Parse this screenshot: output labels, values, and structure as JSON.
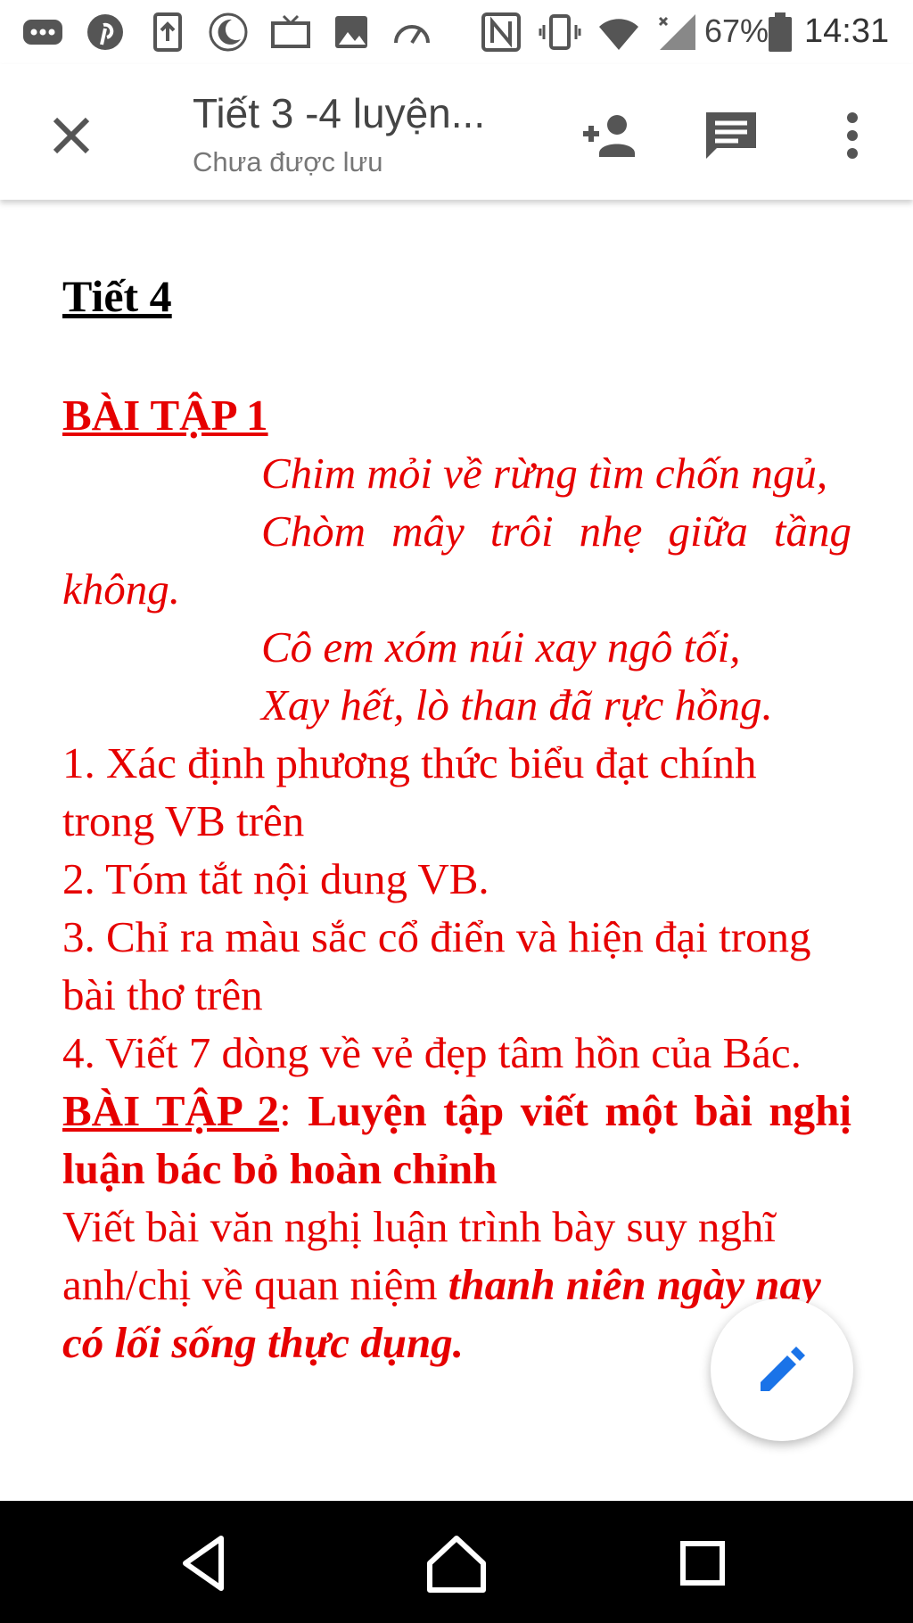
{
  "status_bar": {
    "icons": [
      "more-icon",
      "pinterest-icon",
      "upload-icon",
      "do-not-disturb-icon",
      "tv-icon",
      "image-icon",
      "speedometer-icon",
      "nfc-icon",
      "vibrate-icon",
      "wifi-icon",
      "signal-icon",
      "battery-icon"
    ],
    "battery": "67%",
    "time": "14:31"
  },
  "app_bar": {
    "title": "Tiết 3 -4 luyện...",
    "subtitle": "Chưa được lưu",
    "icons": [
      "close-icon",
      "add-person-icon",
      "comment-icon",
      "more-vert-icon"
    ]
  },
  "document": {
    "heading": "Tiết 4",
    "ex1_title": "BÀI TẬP 1",
    "poem": [
      "Chim mỏi về rừng tìm chốn ngủ,",
      "Chòm mây trôi nhẹ giữa tầng không.",
      "Cô em xóm núi xay ngô tối,",
      "Xay hết, lò than đã rực hồng."
    ],
    "q1": "1. Xác định phương thức biểu đạt chính trong VB trên",
    "q2": "2. Tóm tắt nội dung VB.",
    "q3": "3. Chỉ ra màu sắc cổ điển và hiện đại trong bài thơ trên",
    "q4": "4. Viết 7 dòng về vẻ đẹp tâm hồn của Bác.",
    "ex2_title": "BÀI TẬP 2",
    "ex2_colon": ": ",
    "ex2_desc": "Luyện tập viết một bài nghị luận bác bỏ hoàn chỉnh",
    "ex2_body": "Viết bài văn nghị luận trình bày suy nghĩ anh/chị về quan niệm ",
    "ex2_emph": "thanh niên ngày nay có lối sống thực dụng."
  },
  "fab": {
    "icon": "edit-icon"
  },
  "nav_bar": {
    "icons": [
      "back-icon",
      "home-icon",
      "recents-icon"
    ]
  },
  "colors": {
    "text_red": "#e60000",
    "nav_bg": "#000000"
  }
}
